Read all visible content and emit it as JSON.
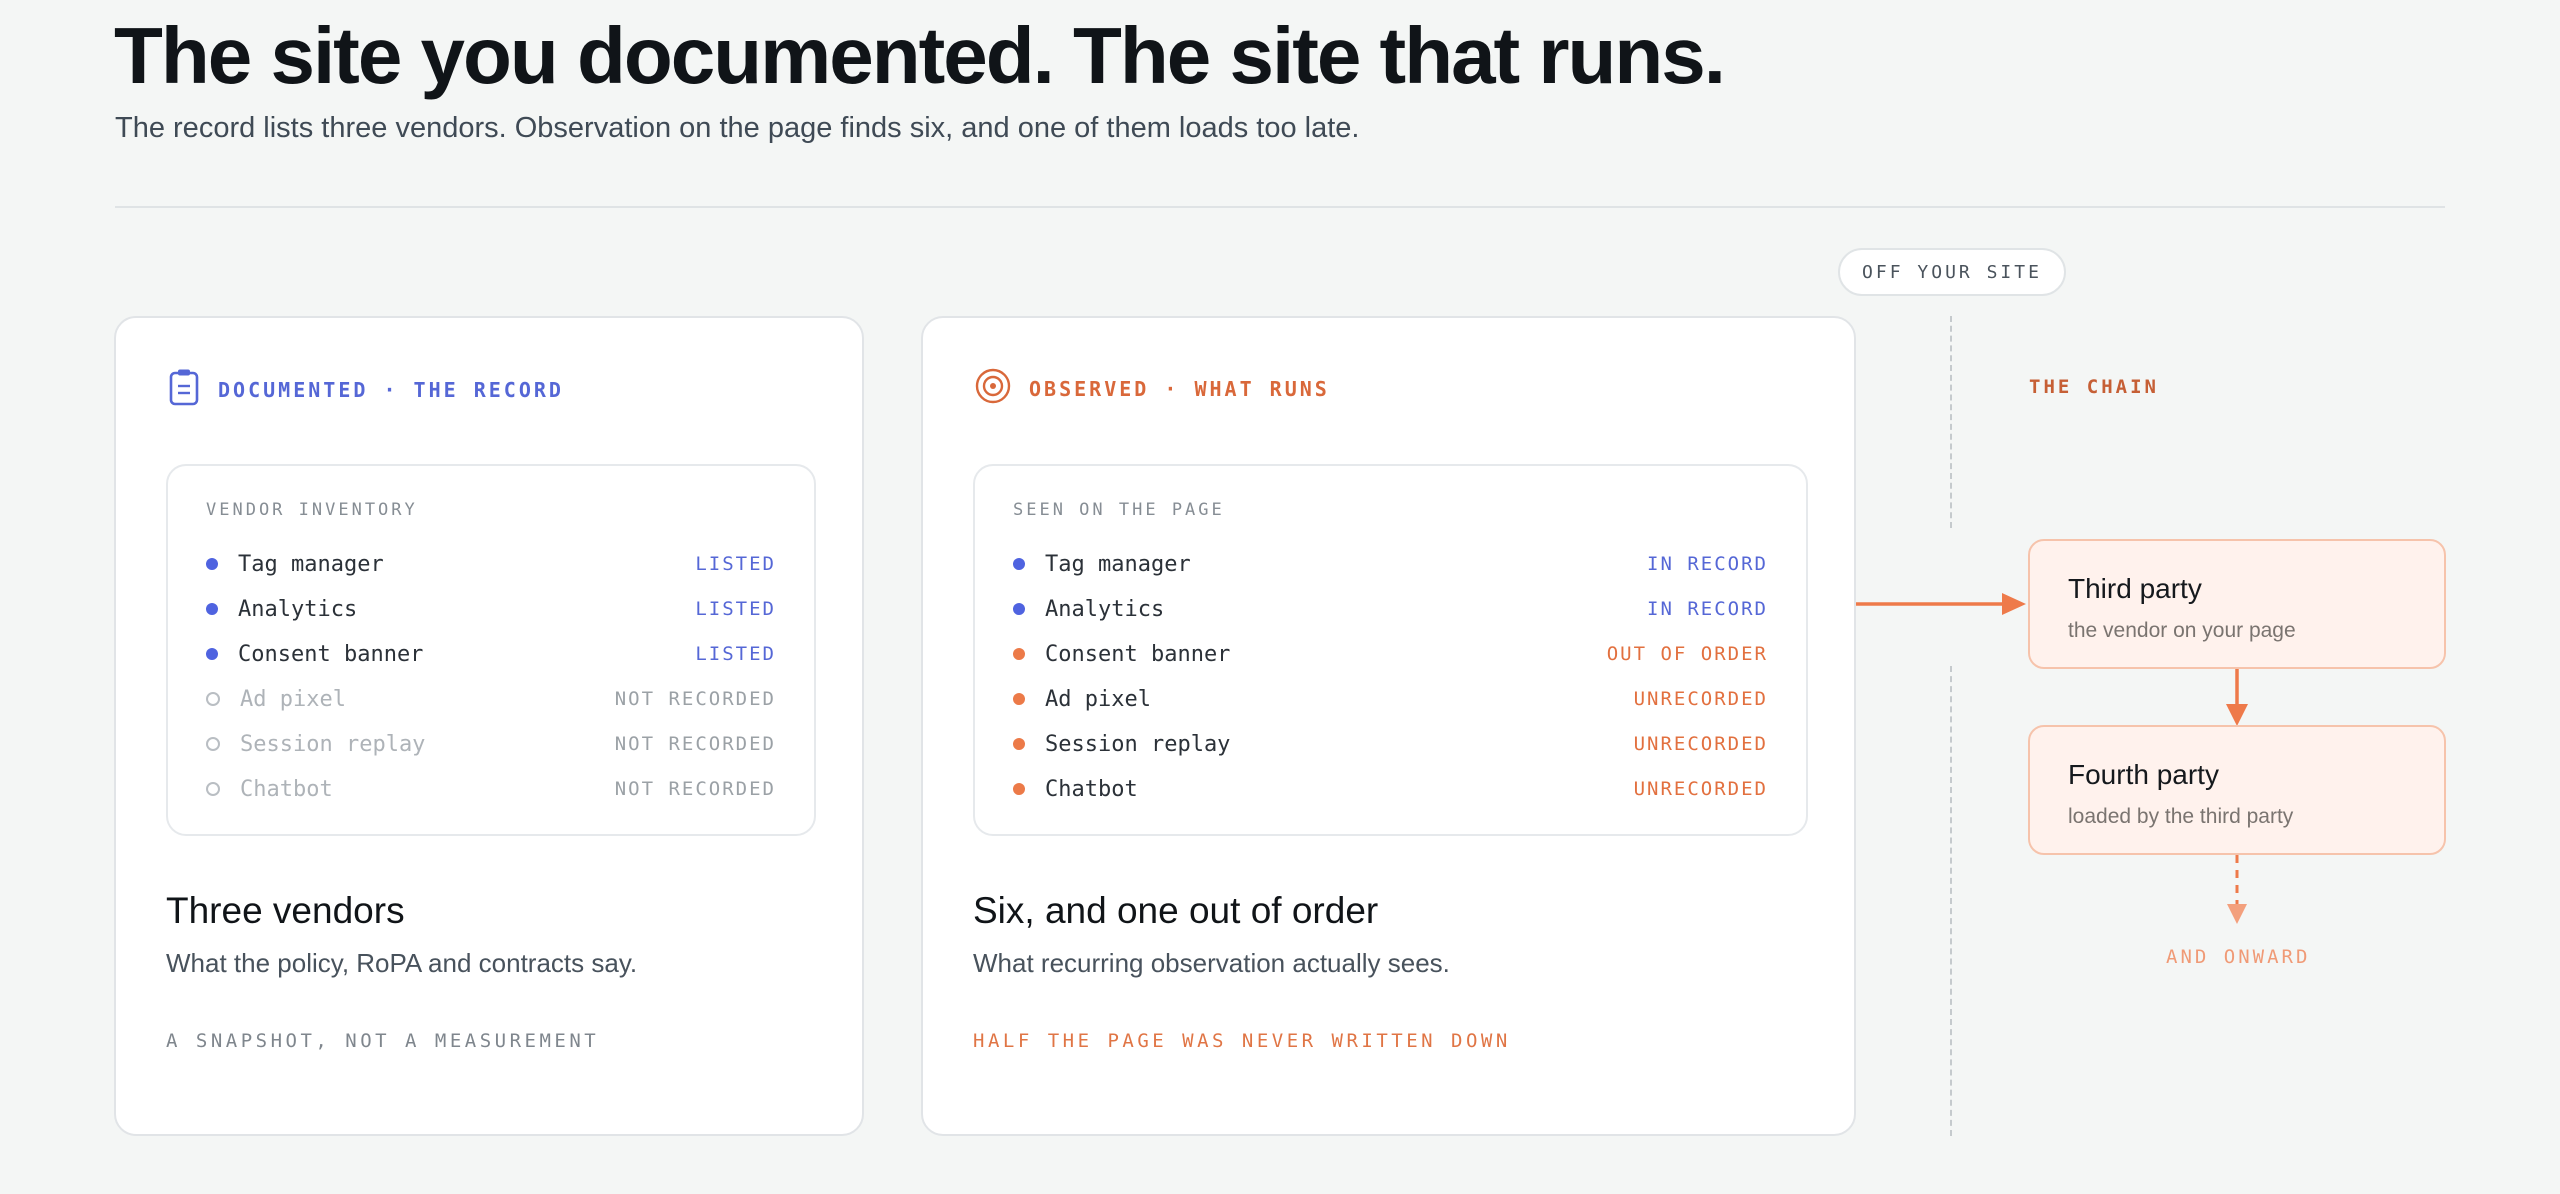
{
  "header": {
    "title": "The site you documented. The site that runs.",
    "subtitle": "The record lists three vendors. Observation on the page finds six, and one of them loads too late."
  },
  "documented": {
    "label": "DOCUMENTED · THE RECORD",
    "icon": "clipboard-icon",
    "inventory_title": "VENDOR INVENTORY",
    "rows": [
      {
        "name": "Tag manager",
        "status": "LISTED"
      },
      {
        "name": "Analytics",
        "status": "LISTED"
      },
      {
        "name": "Consent banner",
        "status": "LISTED"
      },
      {
        "name": "Ad pixel",
        "status": "NOT RECORDED"
      },
      {
        "name": "Session replay",
        "status": "NOT RECORDED"
      },
      {
        "name": "Chatbot",
        "status": "NOT RECORDED"
      }
    ],
    "heading": "Three vendors",
    "description": "What the policy, RoPA and contracts say.",
    "footnote": "A SNAPSHOT, NOT A MEASUREMENT"
  },
  "observed": {
    "label": "OBSERVED · WHAT RUNS",
    "icon": "target-icon",
    "inventory_title": "SEEN ON THE PAGE",
    "rows": [
      {
        "name": "Tag manager",
        "status": "IN RECORD"
      },
      {
        "name": "Analytics",
        "status": "IN RECORD"
      },
      {
        "name": "Consent banner",
        "status": "OUT OF ORDER"
      },
      {
        "name": "Ad pixel",
        "status": "UNRECORDED"
      },
      {
        "name": "Session replay",
        "status": "UNRECORDED"
      },
      {
        "name": "Chatbot",
        "status": "UNRECORDED"
      }
    ],
    "heading": "Six, and one out of order",
    "description": "What recurring observation actually sees.",
    "footnote": "HALF THE PAGE WAS NEVER WRITTEN DOWN"
  },
  "chain": {
    "off_site_label": "OFF YOUR SITE",
    "label": "THE CHAIN",
    "third_party": {
      "title": "Third party",
      "subtitle": "the vendor on your page"
    },
    "fourth_party": {
      "title": "Fourth party",
      "subtitle": "loaded by the third party"
    },
    "onward_label": "AND ONWARD"
  },
  "colors": {
    "documented_accent": "#5567d6",
    "observed_accent": "#e2703f",
    "chain_fill": "#fff2ed",
    "chain_border": "#f6c3ab"
  }
}
